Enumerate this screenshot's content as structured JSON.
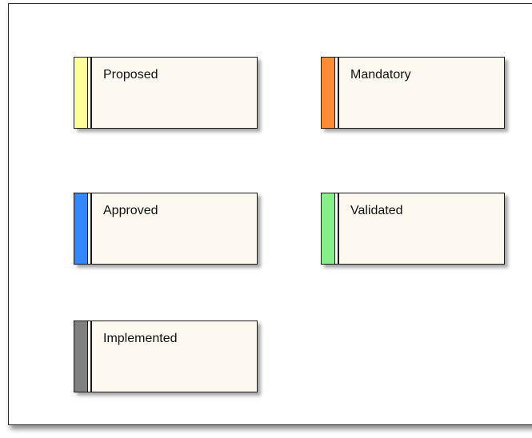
{
  "requirements": [
    {
      "label": "Proposed",
      "color": "#ffff99"
    },
    {
      "label": "Mandatory",
      "color": "#ff8c33"
    },
    {
      "label": "Approved",
      "color": "#3388ff"
    },
    {
      "label": "Validated",
      "color": "#88ee88"
    },
    {
      "label": "Implemented",
      "color": "#808080"
    }
  ]
}
